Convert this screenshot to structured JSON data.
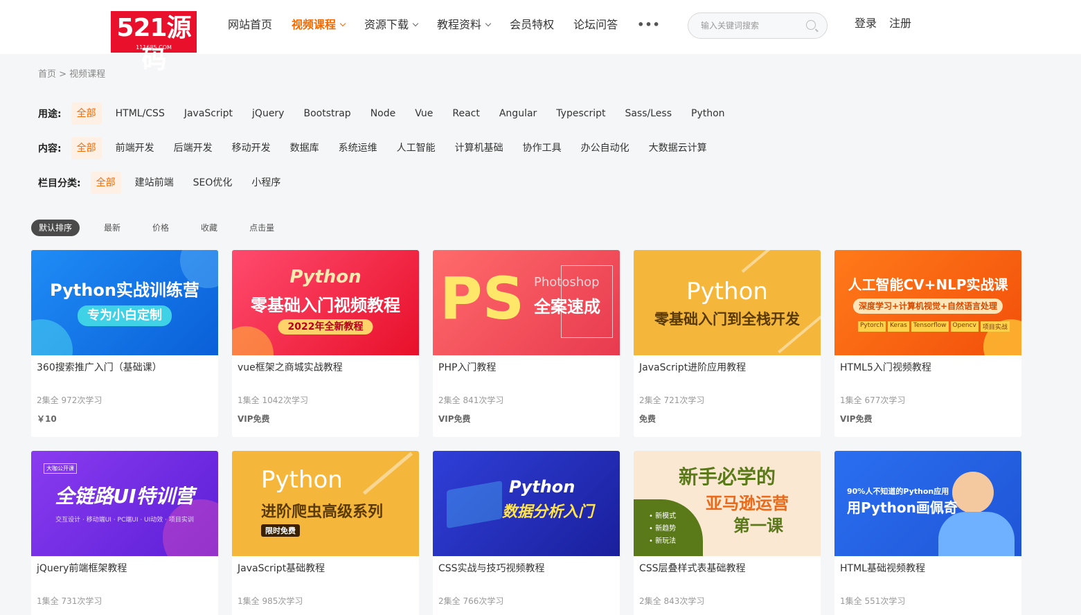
{
  "header": {
    "logo_text": "521源码",
    "logo_sub": "111685.COM",
    "nav": [
      {
        "label": "网站首页",
        "dropdown": false,
        "active": false
      },
      {
        "label": "视频课程",
        "dropdown": true,
        "active": true
      },
      {
        "label": "资源下载",
        "dropdown": true,
        "active": false
      },
      {
        "label": "教程资料",
        "dropdown": true,
        "active": false
      },
      {
        "label": "会员特权",
        "dropdown": false,
        "active": false
      },
      {
        "label": "论坛问答",
        "dropdown": false,
        "active": false
      }
    ],
    "more": "•••",
    "search_placeholder": "输入关键词搜索",
    "login": "登录",
    "register": "注册"
  },
  "breadcrumb": "首页 > 视频课程",
  "filters": [
    {
      "label": "用途:",
      "options": [
        "全部",
        "HTML/CSS",
        "JavaScript",
        "jQuery",
        "Bootstrap",
        "Node",
        "Vue",
        "React",
        "Angular",
        "Typescript",
        "Sass/Less",
        "Python"
      ],
      "active": 0
    },
    {
      "label": "内容:",
      "options": [
        "全部",
        "前端开发",
        "后端开发",
        "移动开发",
        "数据库",
        "系统运维",
        "人工智能",
        "计算机基础",
        "协作工具",
        "办公自动化",
        "大数据云计算"
      ],
      "active": 0
    },
    {
      "label": "栏目分类:",
      "options": [
        "全部",
        "建站前端",
        "SEO优化",
        "小程序"
      ],
      "active": 0
    }
  ],
  "sort": {
    "options": [
      "默认排序",
      "最新",
      "价格",
      "收藏",
      "点击量"
    ],
    "active": 0
  },
  "colors": {
    "accent": "#f56a00",
    "logo_red": "#e8102a"
  },
  "courses": [
    {
      "thumb_title": "Python实战训练营",
      "thumb_sub": "专为小白定制",
      "title": "360搜索推广入门（基础课）",
      "meta": "2集全 972次学习",
      "price": "￥10"
    },
    {
      "thumb_title": "Python",
      "thumb_sub": "零基础入门视频教程",
      "thumb_sub2": "2022年全新教程",
      "title": "vue框架之商城实战教程",
      "meta": "1集全 1042次学习",
      "price": "VIP免费"
    },
    {
      "thumb_title": "PS",
      "thumb_sub": "全案速成",
      "thumb_sub2": "Photoshop",
      "title": "PHP入门教程",
      "meta": "2集全 841次学习",
      "price": "VIP免费"
    },
    {
      "thumb_title": "Python",
      "thumb_sub": "零基础入门到全栈开发",
      "title": "JavaScript进阶应用教程",
      "meta": "2集全 721次学习",
      "price": "免费"
    },
    {
      "thumb_title": "人工智能CV+NLP实战课",
      "thumb_sub": "深度学习+计算机视觉+自然语言处理",
      "tags": [
        "Pytorch",
        "Keras",
        "Tensorflow",
        "Opencv",
        "项目实战"
      ],
      "title": "HTML5入门视频教程",
      "meta": "1集全 677次学习",
      "price": "VIP免费"
    },
    {
      "thumb_title": "全链路UI特训营",
      "thumb_sub": "交互设计 · 移动端UI · PC端UI · UI动效 · 项目实训",
      "thumb_badge": "大咖公开课",
      "title": "jQuery前端框架教程",
      "meta": "1集全 731次学习",
      "price": ""
    },
    {
      "thumb_title": "Python",
      "thumb_sub": "进阶爬虫高级系列",
      "thumb_sub2": "限时免费",
      "title": "JavaScript基础教程",
      "meta": "1集全 985次学习",
      "price": ""
    },
    {
      "thumb_title": "Python",
      "thumb_sub": "数据分析入门",
      "title": "CSS实战与技巧视频教程",
      "meta": "2集全 766次学习",
      "price": ""
    },
    {
      "thumb_title": "新手必学的",
      "thumb_sub": "亚马逊运营",
      "thumb_sub2": "第一课",
      "bullets": [
        "• 新模式",
        "• 新趋势",
        "• 新玩法"
      ],
      "title": "CSS层叠样式表基础教程",
      "meta": "2集全 843次学习",
      "price": ""
    },
    {
      "thumb_title": "90%人不知道的Python应用",
      "thumb_sub": "用Python画佩奇",
      "title": "HTML基础视频教程",
      "meta": "1集全 551次学习",
      "price": ""
    }
  ]
}
